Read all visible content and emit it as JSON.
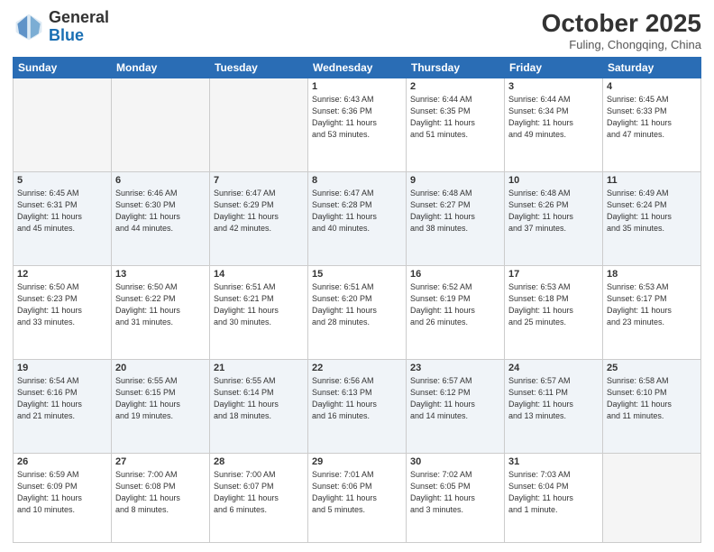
{
  "header": {
    "logo_line1": "General",
    "logo_line2": "Blue",
    "month": "October 2025",
    "location": "Fuling, Chongqing, China"
  },
  "weekdays": [
    "Sunday",
    "Monday",
    "Tuesday",
    "Wednesday",
    "Thursday",
    "Friday",
    "Saturday"
  ],
  "weeks": [
    [
      {
        "day": "",
        "info": ""
      },
      {
        "day": "",
        "info": ""
      },
      {
        "day": "",
        "info": ""
      },
      {
        "day": "1",
        "info": "Sunrise: 6:43 AM\nSunset: 6:36 PM\nDaylight: 11 hours\nand 53 minutes."
      },
      {
        "day": "2",
        "info": "Sunrise: 6:44 AM\nSunset: 6:35 PM\nDaylight: 11 hours\nand 51 minutes."
      },
      {
        "day": "3",
        "info": "Sunrise: 6:44 AM\nSunset: 6:34 PM\nDaylight: 11 hours\nand 49 minutes."
      },
      {
        "day": "4",
        "info": "Sunrise: 6:45 AM\nSunset: 6:33 PM\nDaylight: 11 hours\nand 47 minutes."
      }
    ],
    [
      {
        "day": "5",
        "info": "Sunrise: 6:45 AM\nSunset: 6:31 PM\nDaylight: 11 hours\nand 45 minutes."
      },
      {
        "day": "6",
        "info": "Sunrise: 6:46 AM\nSunset: 6:30 PM\nDaylight: 11 hours\nand 44 minutes."
      },
      {
        "day": "7",
        "info": "Sunrise: 6:47 AM\nSunset: 6:29 PM\nDaylight: 11 hours\nand 42 minutes."
      },
      {
        "day": "8",
        "info": "Sunrise: 6:47 AM\nSunset: 6:28 PM\nDaylight: 11 hours\nand 40 minutes."
      },
      {
        "day": "9",
        "info": "Sunrise: 6:48 AM\nSunset: 6:27 PM\nDaylight: 11 hours\nand 38 minutes."
      },
      {
        "day": "10",
        "info": "Sunrise: 6:48 AM\nSunset: 6:26 PM\nDaylight: 11 hours\nand 37 minutes."
      },
      {
        "day": "11",
        "info": "Sunrise: 6:49 AM\nSunset: 6:24 PM\nDaylight: 11 hours\nand 35 minutes."
      }
    ],
    [
      {
        "day": "12",
        "info": "Sunrise: 6:50 AM\nSunset: 6:23 PM\nDaylight: 11 hours\nand 33 minutes."
      },
      {
        "day": "13",
        "info": "Sunrise: 6:50 AM\nSunset: 6:22 PM\nDaylight: 11 hours\nand 31 minutes."
      },
      {
        "day": "14",
        "info": "Sunrise: 6:51 AM\nSunset: 6:21 PM\nDaylight: 11 hours\nand 30 minutes."
      },
      {
        "day": "15",
        "info": "Sunrise: 6:51 AM\nSunset: 6:20 PM\nDaylight: 11 hours\nand 28 minutes."
      },
      {
        "day": "16",
        "info": "Sunrise: 6:52 AM\nSunset: 6:19 PM\nDaylight: 11 hours\nand 26 minutes."
      },
      {
        "day": "17",
        "info": "Sunrise: 6:53 AM\nSunset: 6:18 PM\nDaylight: 11 hours\nand 25 minutes."
      },
      {
        "day": "18",
        "info": "Sunrise: 6:53 AM\nSunset: 6:17 PM\nDaylight: 11 hours\nand 23 minutes."
      }
    ],
    [
      {
        "day": "19",
        "info": "Sunrise: 6:54 AM\nSunset: 6:16 PM\nDaylight: 11 hours\nand 21 minutes."
      },
      {
        "day": "20",
        "info": "Sunrise: 6:55 AM\nSunset: 6:15 PM\nDaylight: 11 hours\nand 19 minutes."
      },
      {
        "day": "21",
        "info": "Sunrise: 6:55 AM\nSunset: 6:14 PM\nDaylight: 11 hours\nand 18 minutes."
      },
      {
        "day": "22",
        "info": "Sunrise: 6:56 AM\nSunset: 6:13 PM\nDaylight: 11 hours\nand 16 minutes."
      },
      {
        "day": "23",
        "info": "Sunrise: 6:57 AM\nSunset: 6:12 PM\nDaylight: 11 hours\nand 14 minutes."
      },
      {
        "day": "24",
        "info": "Sunrise: 6:57 AM\nSunset: 6:11 PM\nDaylight: 11 hours\nand 13 minutes."
      },
      {
        "day": "25",
        "info": "Sunrise: 6:58 AM\nSunset: 6:10 PM\nDaylight: 11 hours\nand 11 minutes."
      }
    ],
    [
      {
        "day": "26",
        "info": "Sunrise: 6:59 AM\nSunset: 6:09 PM\nDaylight: 11 hours\nand 10 minutes."
      },
      {
        "day": "27",
        "info": "Sunrise: 7:00 AM\nSunset: 6:08 PM\nDaylight: 11 hours\nand 8 minutes."
      },
      {
        "day": "28",
        "info": "Sunrise: 7:00 AM\nSunset: 6:07 PM\nDaylight: 11 hours\nand 6 minutes."
      },
      {
        "day": "29",
        "info": "Sunrise: 7:01 AM\nSunset: 6:06 PM\nDaylight: 11 hours\nand 5 minutes."
      },
      {
        "day": "30",
        "info": "Sunrise: 7:02 AM\nSunset: 6:05 PM\nDaylight: 11 hours\nand 3 minutes."
      },
      {
        "day": "31",
        "info": "Sunrise: 7:03 AM\nSunset: 6:04 PM\nDaylight: 11 hours\nand 1 minute."
      },
      {
        "day": "",
        "info": ""
      }
    ]
  ]
}
